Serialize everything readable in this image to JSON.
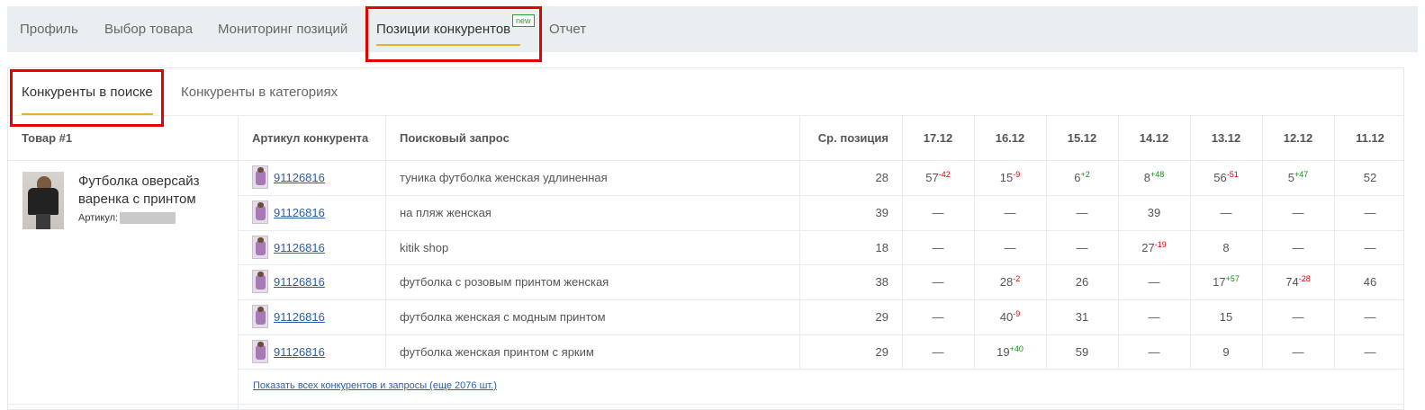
{
  "top_nav": {
    "tabs": [
      {
        "label": "Профиль"
      },
      {
        "label": "Выбор товара"
      },
      {
        "label": "Мониторинг позиций"
      },
      {
        "label": "Позиции конкурентов",
        "badge": "new"
      },
      {
        "label": "Отчет"
      }
    ],
    "active_index": 3
  },
  "sub_tabs": {
    "tabs": [
      {
        "label": "Конкуренты в поиске"
      },
      {
        "label": "Конкуренты в категориях"
      }
    ],
    "active_index": 0
  },
  "table": {
    "headers": {
      "product": "Товар #1",
      "article": "Артикул конкурента",
      "query": "Поисковый запрос",
      "avg_position": "Ср. позиция",
      "dates": [
        "17.12",
        "16.12",
        "15.12",
        "14.12",
        "13.12",
        "12.12",
        "11.12"
      ]
    },
    "product": {
      "name": "Футболка оверсайз варенка с принтом",
      "article_label": "Артикул:"
    },
    "rows": [
      {
        "article": "91126816",
        "query": "туника футболка женская удлиненная",
        "avg": "28",
        "cells": [
          {
            "v": "57",
            "d": "-42"
          },
          {
            "v": "15",
            "d": "-9"
          },
          {
            "v": "6",
            "d": "+2"
          },
          {
            "v": "8",
            "d": "+48"
          },
          {
            "v": "56",
            "d": "-51"
          },
          {
            "v": "5",
            "d": "+47"
          },
          {
            "v": "52",
            "d": ""
          }
        ]
      },
      {
        "article": "91126816",
        "query": "на пляж женская",
        "avg": "39",
        "cells": [
          {
            "v": "—",
            "d": ""
          },
          {
            "v": "—",
            "d": ""
          },
          {
            "v": "—",
            "d": ""
          },
          {
            "v": "39",
            "d": ""
          },
          {
            "v": "—",
            "d": ""
          },
          {
            "v": "—",
            "d": ""
          },
          {
            "v": "—",
            "d": ""
          }
        ]
      },
      {
        "article": "91126816",
        "query": "kitik shop",
        "avg": "18",
        "cells": [
          {
            "v": "—",
            "d": ""
          },
          {
            "v": "—",
            "d": ""
          },
          {
            "v": "—",
            "d": ""
          },
          {
            "v": "27",
            "d": "-19"
          },
          {
            "v": "8",
            "d": ""
          },
          {
            "v": "—",
            "d": ""
          },
          {
            "v": "—",
            "d": ""
          }
        ]
      },
      {
        "article": "91126816",
        "query": "футболка с розовым принтом женская",
        "avg": "38",
        "cells": [
          {
            "v": "—",
            "d": ""
          },
          {
            "v": "28",
            "d": "-2"
          },
          {
            "v": "26",
            "d": ""
          },
          {
            "v": "—",
            "d": ""
          },
          {
            "v": "17",
            "d": "+57"
          },
          {
            "v": "74",
            "d": "-28"
          },
          {
            "v": "46",
            "d": ""
          }
        ]
      },
      {
        "article": "91126816",
        "query": "футболка женская с модным принтом",
        "avg": "29",
        "cells": [
          {
            "v": "—",
            "d": ""
          },
          {
            "v": "40",
            "d": "-9"
          },
          {
            "v": "31",
            "d": ""
          },
          {
            "v": "—",
            "d": ""
          },
          {
            "v": "15",
            "d": ""
          },
          {
            "v": "—",
            "d": ""
          },
          {
            "v": "—",
            "d": ""
          }
        ]
      },
      {
        "article": "91126816",
        "query": "футболка женская принтом с ярким",
        "avg": "29",
        "cells": [
          {
            "v": "—",
            "d": ""
          },
          {
            "v": "19",
            "d": "+40"
          },
          {
            "v": "59",
            "d": ""
          },
          {
            "v": "—",
            "d": ""
          },
          {
            "v": "9",
            "d": ""
          },
          {
            "v": "—",
            "d": ""
          },
          {
            "v": "—",
            "d": ""
          }
        ]
      }
    ],
    "show_all": "Показать всех конкурентов и запросы (еще 2076 шт.)"
  },
  "colors": {
    "accent_underline": "#f0ad2c",
    "highlight_box": "#e60000",
    "link": "#2a5ea8",
    "delta_negative": "#e00000",
    "delta_positive": "#1a8a1a",
    "badge": "#2b9a3c"
  }
}
